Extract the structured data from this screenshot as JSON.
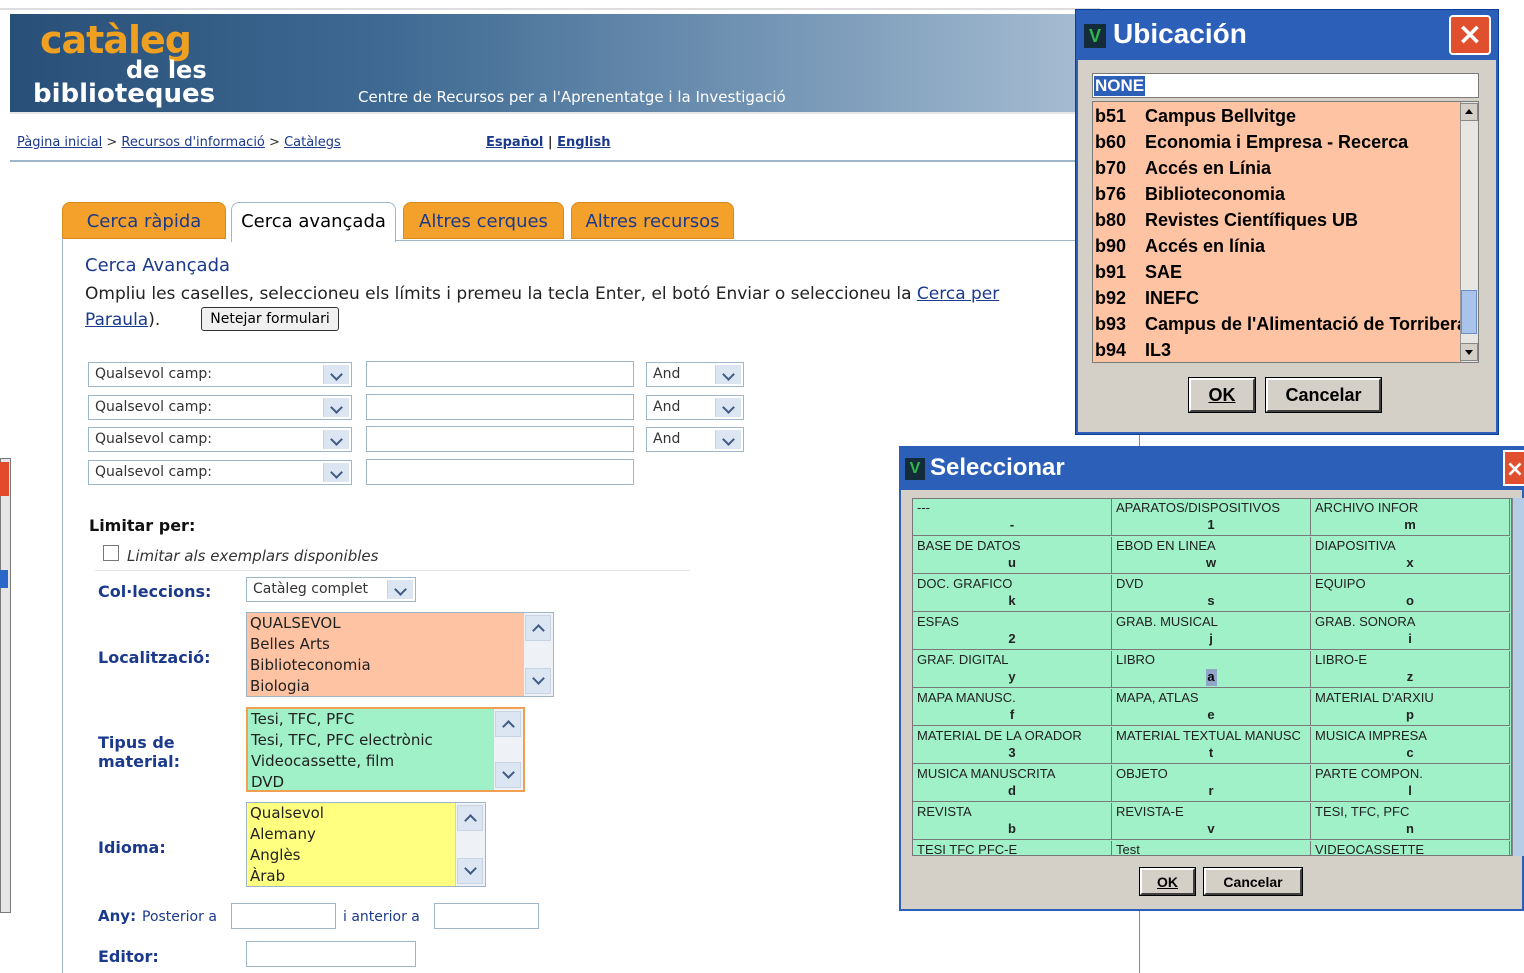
{
  "header": {
    "logo_catalog": "catàleg",
    "logo_de": "de les",
    "logo_bib": "biblioteques",
    "tagline": "Centre de Recursos per a l'Aprenentatge i la Investigació"
  },
  "breadcrumb": {
    "home": "Pàgina inicial",
    "sep1": " > ",
    "resources": "Recursos d'informació",
    "sep2": " > ",
    "catalogs": "Catàlegs"
  },
  "languages": {
    "es": "Español",
    "sep": " | ",
    "en": "English"
  },
  "tabs": [
    {
      "label": "Cerca ràpida"
    },
    {
      "label": "Cerca avançada"
    },
    {
      "label": "Altres cerques"
    },
    {
      "label": "Altres recursos"
    }
  ],
  "advanced": {
    "title": "Cerca Avançada",
    "desc_pre": "Ompliu les caselles, seleccioneu els límits i premeu la tecla Enter, el botó Enviar o seleccioneu la ",
    "desc_link": "Cerca per Paraula",
    "desc_post": ").",
    "clear_button": "Netejar formulari"
  },
  "search_rows": [
    {
      "field": "Qualsevol camp:",
      "op": "And"
    },
    {
      "field": "Qualsevol camp:",
      "op": "And"
    },
    {
      "field": "Qualsevol camp:",
      "op": "And"
    },
    {
      "field": "Qualsevol camp:"
    }
  ],
  "limits": {
    "label": "Limitar per:",
    "available_label": "Limitar als exemplars disponibles",
    "collections_label": "Col·leccions:",
    "collections_value": "Catàleg complet",
    "location_label": "Localització:",
    "location_items": [
      "QUALSEVOL",
      "Belles Arts",
      "Biblioteconomia",
      "Biologia"
    ],
    "material_label": "Tipus de material:",
    "material_items": [
      "Tesi, TFC, PFC",
      "Tesi, TFC, PFC electrònic",
      "Videocassette, film",
      "DVD"
    ],
    "language_label": "Idioma:",
    "language_items": [
      "Qualsevol",
      "Alemany",
      "Anglès",
      "Àrab"
    ],
    "year_label": "Any:",
    "year_after": "Posterior a",
    "year_before": "i anterior a",
    "editor_label": "Editor:"
  },
  "colors": {
    "tab_orange": "#f3a12b",
    "location_bg": "#fec3a2",
    "material_bg": "#a0f0c8",
    "language_bg": "#ffff80",
    "title_blue": "#2c5fb8",
    "link_blue": "#1b3a8c"
  },
  "ubicacion": {
    "title": "Ubicación",
    "logo": "V",
    "input_value": "NONE",
    "items": [
      {
        "code": "b51",
        "name": "Campus Bellvitge"
      },
      {
        "code": "b60",
        "name": "Economia i Empresa - Recerca"
      },
      {
        "code": "b70",
        "name": "Accés en Línia"
      },
      {
        "code": "b76",
        "name": "Biblioteconomia"
      },
      {
        "code": "b80",
        "name": "Revistes Científiques UB"
      },
      {
        "code": "b90",
        "name": "Accés en línia"
      },
      {
        "code": "b91",
        "name": "SAE"
      },
      {
        "code": "b92",
        "name": "INEFC"
      },
      {
        "code": "b93",
        "name": "Campus de l'Alimentació de Torribera"
      },
      {
        "code": "b94",
        "name": "IL3"
      }
    ],
    "ok": "OK",
    "cancel": "Cancelar",
    "close_icon": "×"
  },
  "seleccionar": {
    "title": "Seleccionar",
    "logo": "V",
    "cells": [
      {
        "name": "---",
        "code": "-"
      },
      {
        "name": "APARATOS/DISPOSITIVOS",
        "code": "1"
      },
      {
        "name": "ARCHIVO INFOR",
        "code": "m"
      },
      {
        "name": "BASE DE DATOS",
        "code": "u"
      },
      {
        "name": "EBOD EN LINEA",
        "code": "w"
      },
      {
        "name": "DIAPOSITIVA",
        "code": "x"
      },
      {
        "name": "DOC. GRAFICO",
        "code": "k"
      },
      {
        "name": "DVD",
        "code": "s"
      },
      {
        "name": "EQUIPO",
        "code": "o"
      },
      {
        "name": "ESFAS",
        "code": "2"
      },
      {
        "name": "GRAB. MUSICAL",
        "code": "j"
      },
      {
        "name": "GRAB. SONORA",
        "code": "i"
      },
      {
        "name": "GRAF. DIGITAL",
        "code": "y"
      },
      {
        "name": "LIBRO",
        "code": "a"
      },
      {
        "name": "LIBRO-E",
        "code": "z"
      },
      {
        "name": "MAPA MANUSC.",
        "code": "f"
      },
      {
        "name": "MAPA, ATLAS",
        "code": "e"
      },
      {
        "name": "MATERIAL D'ARXIU",
        "code": "p"
      },
      {
        "name": "MATERIAL DE LA ORADOR",
        "code": "3"
      },
      {
        "name": "MATERIAL TEXTUAL MANUSC",
        "code": "t"
      },
      {
        "name": "MUSICA IMPRESA",
        "code": "c"
      },
      {
        "name": "MUSICA MANUSCRITA",
        "code": "d"
      },
      {
        "name": "OBJETO",
        "code": "r"
      },
      {
        "name": "PARTE COMPON.",
        "code": "l"
      },
      {
        "name": "REVISTA",
        "code": "b"
      },
      {
        "name": "REVISTA-E",
        "code": "v"
      },
      {
        "name": "TESI, TFC, PFC",
        "code": "n"
      },
      {
        "name": "TESI TFC PFC-E",
        "code": ""
      },
      {
        "name": "Test",
        "code": ""
      },
      {
        "name": "VIDEOCASSETTE",
        "code": ""
      }
    ],
    "ok": "OK",
    "cancel": "Cancelar"
  }
}
